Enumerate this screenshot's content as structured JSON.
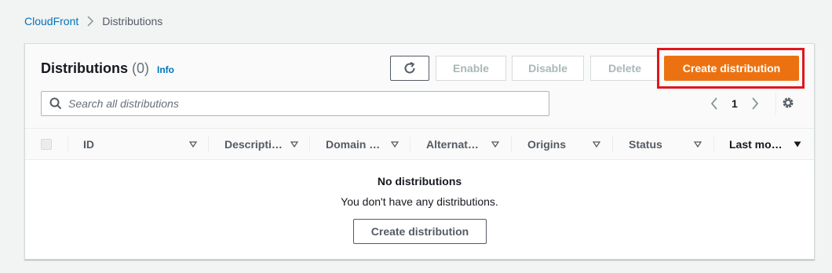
{
  "breadcrumb": {
    "root": "CloudFront",
    "current": "Distributions"
  },
  "header": {
    "title": "Distributions",
    "count": "(0)",
    "info": "Info"
  },
  "actions": {
    "refresh_icon": "refresh-icon",
    "enable": "Enable",
    "disable": "Disable",
    "delete": "Delete",
    "create": "Create distribution"
  },
  "search": {
    "placeholder": "Search all distributions",
    "value": ""
  },
  "pagination": {
    "current_page": "1"
  },
  "table": {
    "columns": [
      {
        "label": "ID",
        "sort": "sortable"
      },
      {
        "label": "Descripti…",
        "sort": "sortable"
      },
      {
        "label": "Domain …",
        "sort": "sortable"
      },
      {
        "label": "Alternat…",
        "sort": "sortable"
      },
      {
        "label": "Origins",
        "sort": "sortable"
      },
      {
        "label": "Status",
        "sort": "sortable"
      },
      {
        "label": "Last mo…",
        "sort": "sorted-descending"
      }
    ]
  },
  "empty_state": {
    "title": "No distributions",
    "message": "You don't have any distributions.",
    "button": "Create distribution"
  },
  "colors": {
    "primary": "#ec7211",
    "link": "#0073bb",
    "highlight": "#e0161e",
    "background": "#f2f3f3"
  }
}
